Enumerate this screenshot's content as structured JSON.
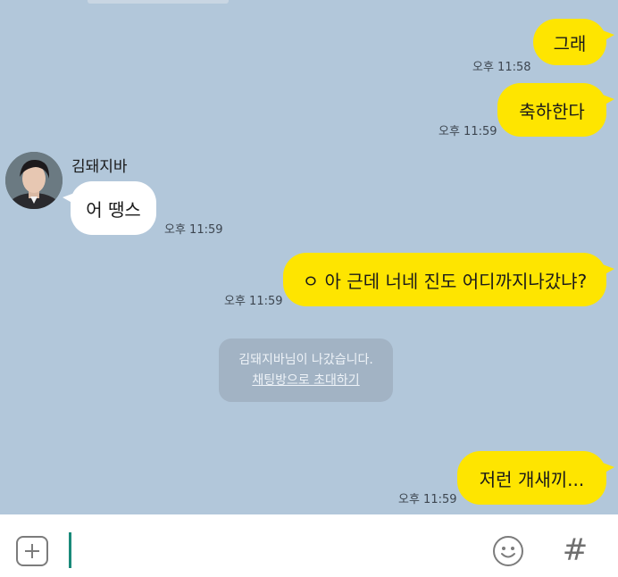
{
  "contact": {
    "name": "김돼지바"
  },
  "messages": [
    {
      "from": "me",
      "text": "그래",
      "time": "오후 11:58"
    },
    {
      "from": "me",
      "text": "축하한다",
      "time": "오후 11:59"
    },
    {
      "from": "other",
      "text": "어 땡스",
      "time": "오후 11:59"
    },
    {
      "from": "me",
      "text": "ㅇ 아 근데 너네 진도 어디까지나갔냐?",
      "time": "오후 11:59"
    },
    {
      "from": "me",
      "text": "저런 개새끼...",
      "time": "오후 11:59"
    }
  ],
  "system_notice": {
    "text": "김돼지바님이 나갔습니다.",
    "link": "채팅방으로 초대하기"
  },
  "input_bar": {
    "placeholder": "",
    "icons": [
      "plus-icon",
      "smiley-icon",
      "hash-icon"
    ],
    "hash_glyph": "#"
  },
  "colors": {
    "chat_background": "#b2c7da",
    "my_bubble": "#fee500",
    "their_bubble": "#ffffff",
    "notice_background": "#a2b3c4",
    "cursor": "#1a8a7a"
  }
}
